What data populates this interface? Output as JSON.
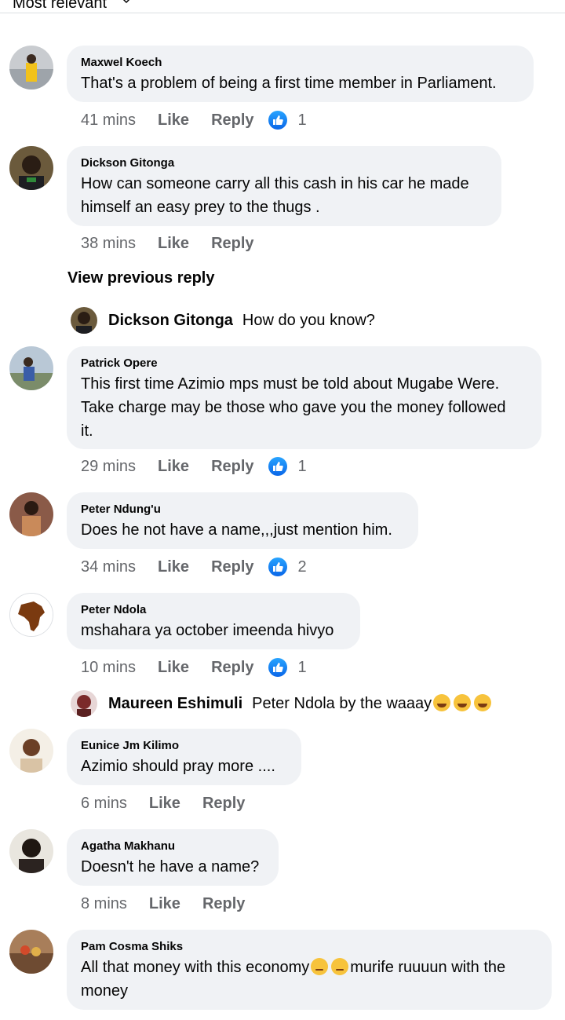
{
  "sort": {
    "label": "Most relevant"
  },
  "colors": {
    "bubble": "#f0f2f5",
    "meta": "#65676b",
    "like_blue": "#1877f2"
  },
  "comments": [
    {
      "author": "Maxwel Koech",
      "lines": [
        "That's a problem of being a first time member in Parliament."
      ],
      "time": "41 mins",
      "like": "Like",
      "reply": "Reply",
      "reactions": "1"
    },
    {
      "author": "Dickson Gitonga",
      "lines": [
        "How can someone carry all this cash in his car he made",
        "himself an easy prey to the thugs  ."
      ],
      "time": "38 mins",
      "like": "Like",
      "reply": "Reply"
    },
    {
      "author": "Patrick Opere",
      "lines": [
        "This first time Azimio mps must be told about Mugabe Were.",
        "Take charge may be those who gave you the money followed",
        "it."
      ],
      "time": "29 mins",
      "like": "Like",
      "reply": "Reply",
      "reactions": "1"
    },
    {
      "author": "Peter Ndung'u",
      "lines": [
        "Does he not have a name,,,just mention him."
      ],
      "time": "34 mins",
      "like": "Like",
      "reply": "Reply",
      "reactions": "2"
    },
    {
      "author": "Peter Ndola",
      "lines": [
        "mshahara ya october imeenda hivyo"
      ],
      "time": "10 mins",
      "like": "Like",
      "reply": "Reply",
      "reactions": "1"
    },
    {
      "author": "Eunice Jm Kilimo",
      "lines": [
        "Azimio should pray more ...."
      ],
      "time": "6 mins",
      "like": "Like",
      "reply": "Reply"
    },
    {
      "author": "Agatha Makhanu",
      "lines": [
        "Doesn't he have a name?"
      ],
      "time": "8 mins",
      "like": "Like",
      "reply": "Reply"
    },
    {
      "author": "Pam Cosma Shiks",
      "lines": [
        "All that money with this economy",
        "murife ruuuun with the",
        "money"
      ]
    }
  ],
  "view_previous_reply": "View previous reply",
  "replies": [
    {
      "author": "Dickson Gitonga",
      "text": "How do you know?"
    },
    {
      "author": "Maureen Eshimuli",
      "text": "Peter Ndola by the waaay"
    }
  ]
}
